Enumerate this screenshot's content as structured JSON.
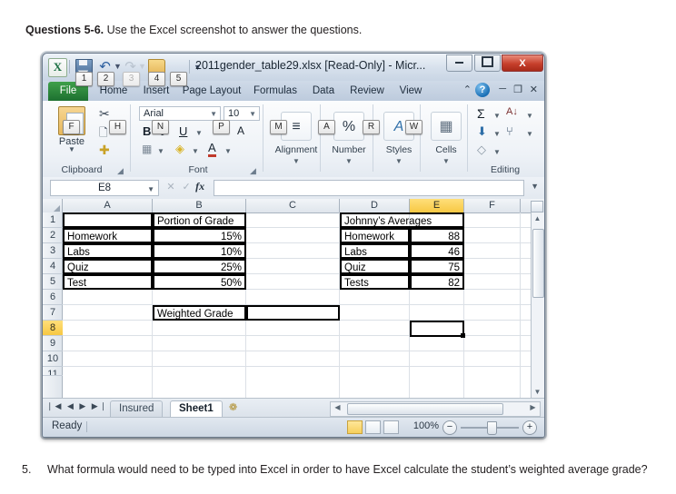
{
  "worksheet": {
    "heading_bold": "Questions 5-6.",
    "heading_rest": " Use the Excel screenshot to answer the questions.",
    "question": {
      "number": "5.",
      "text": "What formula would need to be typed into Excel in order to have Excel calculate the student’s weighted average grade?"
    }
  },
  "excel": {
    "titlebar": {
      "title": "2011gender_table29.xlsx  [Read-Only]  -  Micr...",
      "app_icon": "X",
      "qat": [
        {
          "name": "save",
          "keytip": "1",
          "enabled": true
        },
        {
          "name": "undo",
          "keytip": "2",
          "enabled": true
        },
        {
          "name": "redo",
          "keytip": "3",
          "enabled": false
        },
        {
          "name": "open",
          "keytip": "4",
          "enabled": true
        },
        {
          "name": "print-preview",
          "keytip": "5",
          "enabled": true
        }
      ],
      "window_buttons": {
        "minimize": "─",
        "maximize": "□",
        "close": "X"
      }
    },
    "tabs": [
      {
        "label": "File",
        "keytip": "F",
        "active_file": true
      },
      {
        "label": "Home",
        "keytip": "H"
      },
      {
        "label": "Insert",
        "keytip": "N"
      },
      {
        "label": "Page Layout",
        "keytip": "P"
      },
      {
        "label": "Formulas",
        "keytip": "M"
      },
      {
        "label": "Data",
        "keytip": "A"
      },
      {
        "label": "Review",
        "keytip": "R"
      },
      {
        "label": "View",
        "keytip": "W"
      }
    ],
    "tab_right": {
      "collapse": "⌃",
      "help": "?",
      "doc_min": "─",
      "doc_restore": "❐",
      "doc_close": "✕"
    },
    "ribbon": {
      "clipboard": {
        "label": "Clipboard",
        "paste": "Paste",
        "cut": "✂",
        "copy": "❐",
        "format_painter": "✐"
      },
      "font": {
        "label": "Font",
        "font_name": "Arial",
        "font_size": "10",
        "bold": "B",
        "italic": "I",
        "underline": "U",
        "grow": "A",
        "shrink": "A",
        "borders": "▦",
        "fill_color": "▲",
        "font_color": "A"
      },
      "groups_collapsed": [
        {
          "label": "Alignment",
          "glyph": "≡"
        },
        {
          "label": "Number",
          "glyph": "%"
        },
        {
          "label": "Styles",
          "glyph": "A"
        },
        {
          "label": "Cells",
          "glyph": "▦"
        }
      ],
      "editing": {
        "label": "Editing",
        "autosum": "Σ",
        "sort_filter": "A↓",
        "fill": "⬇",
        "find_select": "⑂",
        "clear": "◇"
      }
    },
    "formula_bar": {
      "name_box": "E8",
      "cancel": "✕",
      "enter": "✓",
      "fx": "fx",
      "formula_value": ""
    },
    "grid": {
      "columns": [
        "A",
        "B",
        "C",
        "D",
        "E",
        "F"
      ],
      "selected_column": "E",
      "rows": [
        "1",
        "2",
        "3",
        "4",
        "5",
        "6",
        "7",
        "8",
        "9",
        "10",
        "11"
      ],
      "selected_row": "8",
      "selected_cell": "E8",
      "cells": [
        {
          "ref": "B1",
          "value": "Portion of Grade",
          "align": "left",
          "boxed": true
        },
        {
          "ref": "A1",
          "value": "",
          "align": "left",
          "boxed": true
        },
        {
          "ref": "D1",
          "value": "Johnny’s Averages",
          "align": "left",
          "boxed": true
        },
        {
          "ref": "A2",
          "value": "Homework",
          "align": "left",
          "boxed": true
        },
        {
          "ref": "B2",
          "value": "15%",
          "align": "right",
          "boxed": true
        },
        {
          "ref": "D2",
          "value": "Homework",
          "align": "left",
          "boxed": true
        },
        {
          "ref": "E2",
          "value": "88",
          "align": "right",
          "boxed": true
        },
        {
          "ref": "A3",
          "value": "Labs",
          "align": "left",
          "boxed": true
        },
        {
          "ref": "B3",
          "value": "10%",
          "align": "right",
          "boxed": true
        },
        {
          "ref": "D3",
          "value": "Labs",
          "align": "left",
          "boxed": true
        },
        {
          "ref": "E3",
          "value": "46",
          "align": "right",
          "boxed": true
        },
        {
          "ref": "A4",
          "value": "Quiz",
          "align": "left",
          "boxed": true
        },
        {
          "ref": "B4",
          "value": "25%",
          "align": "right",
          "boxed": true
        },
        {
          "ref": "D4",
          "value": "Quiz",
          "align": "left",
          "boxed": true
        },
        {
          "ref": "E4",
          "value": "75",
          "align": "right",
          "boxed": true
        },
        {
          "ref": "A5",
          "value": "Test",
          "align": "left",
          "boxed": true
        },
        {
          "ref": "B5",
          "value": "50%",
          "align": "right",
          "boxed": true
        },
        {
          "ref": "D5",
          "value": "Tests",
          "align": "left",
          "boxed": true
        },
        {
          "ref": "E5",
          "value": "82",
          "align": "right",
          "boxed": true
        },
        {
          "ref": "B7",
          "value": "Weighted Grade",
          "align": "left",
          "boxed": true
        },
        {
          "ref": "C7",
          "value": "",
          "align": "left",
          "boxed": true
        }
      ]
    },
    "sheet_tabs": {
      "nav": "❘◀ ◀ ▶ ▶❘",
      "tabs": [
        {
          "label": "Insured",
          "active": false
        },
        {
          "label": "Sheet1",
          "active": true
        }
      ],
      "new_sheet": "❁"
    },
    "status_bar": {
      "status": "Ready",
      "views": [
        "normal",
        "page-layout",
        "page-break"
      ],
      "active_view": "normal",
      "zoom": "100%",
      "zoom_out": "−",
      "zoom_in": "+"
    }
  }
}
